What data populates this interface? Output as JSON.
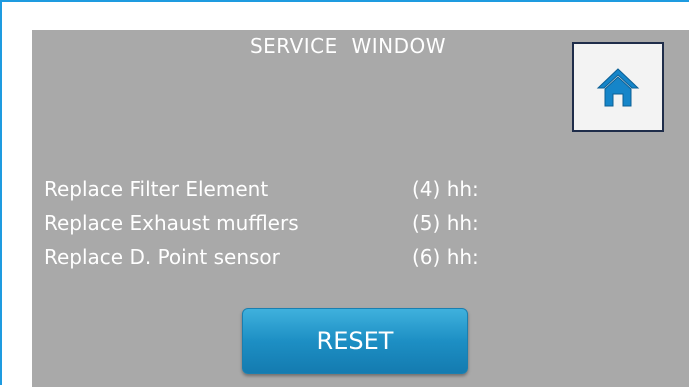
{
  "window": {
    "title": "SERVICE  WINDOW"
  },
  "home_button": {
    "icon": "home-icon",
    "icon_color": "#1585c9"
  },
  "rows": [
    {
      "label": "Replace Filter Element",
      "index": "(4) hh:"
    },
    {
      "label": "Replace Exhaust mufflers",
      "index": "(5) hh:"
    },
    {
      "label": "Replace D. Point sensor",
      "index": "(6) hh:"
    }
  ],
  "reset_button": {
    "label": "RESET"
  },
  "colors": {
    "panel_background": "#a9a9a9",
    "frame_border": "#1e9be0",
    "button_blue": "#1d8fc4",
    "text": "#ffffff"
  }
}
